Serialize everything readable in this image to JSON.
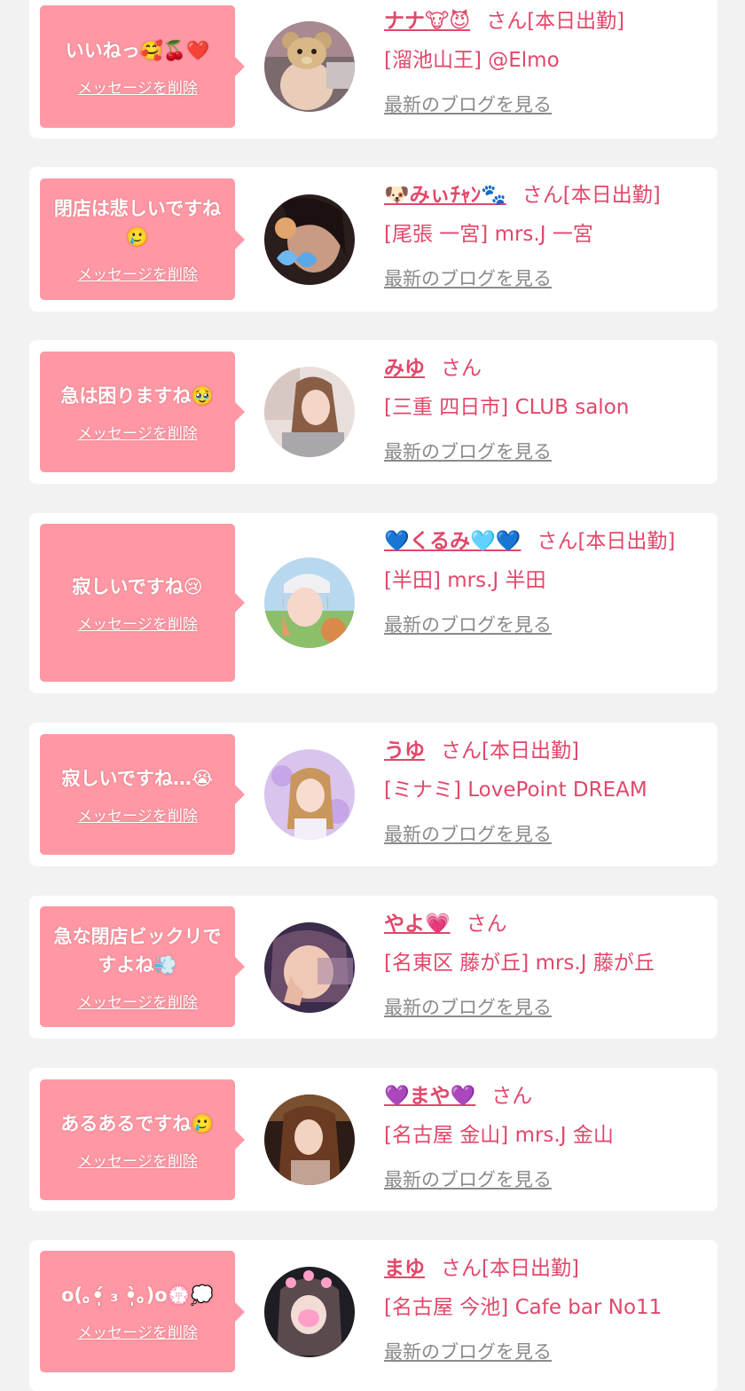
{
  "colors": {
    "background": "#f2f2f2",
    "card": "#ffffff",
    "bubble": "#ff98a4",
    "accent_text": "#e2476a",
    "link_gray": "#8a8a8a"
  },
  "cards": [
    {
      "message": "いいねっ🥰🍒❤️",
      "delete_label": "メッセージを削除",
      "name": "ナナ🐮😈",
      "suffix": "さん[本日出勤]",
      "shop": "[溜池山王] @Elmo",
      "blog_link": "最新のブログを見る",
      "avatar_icon": "teddy-bear-photo"
    },
    {
      "message": "閉店は悲しいですね🥲",
      "delete_label": "メッセージを削除",
      "name": "🐶みぃﾁｬﾝ🐾",
      "suffix": "さん[本日出勤]",
      "shop": "[尾張 一宮] mrs.J 一宮",
      "blog_link": "最新のブログを見る",
      "avatar_icon": "portrait-photo"
    },
    {
      "message": "急は困りますね🥹",
      "delete_label": "メッセージを削除",
      "name": "みゆ",
      "suffix": "さん",
      "shop": "[三重 四日市] CLUB salon",
      "blog_link": "最新のブログを見る",
      "avatar_icon": "portrait-photo"
    },
    {
      "message": "寂しいですね😢",
      "delete_label": "メッセージを削除",
      "name": "💙くるみ🩵💙",
      "suffix": "さん[本日出勤]",
      "shop": "[半田] mrs.J 半田",
      "blog_link": "最新のブログを見る",
      "avatar_icon": "portrait-photo"
    },
    {
      "message": "寂しいですね…😭",
      "delete_label": "メッセージを削除",
      "name": "うゆ",
      "suffix": "さん[本日出勤]",
      "shop": "[ミナミ] LovePoint DREAM",
      "blog_link": "最新のブログを見る",
      "avatar_icon": "portrait-photo"
    },
    {
      "message": "急な閉店ビックリですよね💨",
      "delete_label": "メッセージを削除",
      "name": "やよ💗",
      "suffix": "さん",
      "shop": "[名東区 藤が丘] mrs.J 藤が丘",
      "blog_link": "最新のブログを見る",
      "avatar_icon": "portrait-photo"
    },
    {
      "message": "あるあるですね🥲",
      "delete_label": "メッセージを削除",
      "name": "💜まや💜",
      "suffix": "さん",
      "shop": "[名古屋 金山] mrs.J 金山",
      "blog_link": "最新のブログを見る",
      "avatar_icon": "portrait-photo"
    },
    {
      "message": "o(｡•̩̩̩́ ₃ •̩̩̩̀｡)o💮💭",
      "delete_label": "メッセージを削除",
      "name": "まゆ",
      "suffix": "さん[本日出勤]",
      "shop": "[名古屋 今池] Cafe bar No11",
      "blog_link": "最新のブログを見る",
      "avatar_icon": "portrait-photo"
    }
  ]
}
